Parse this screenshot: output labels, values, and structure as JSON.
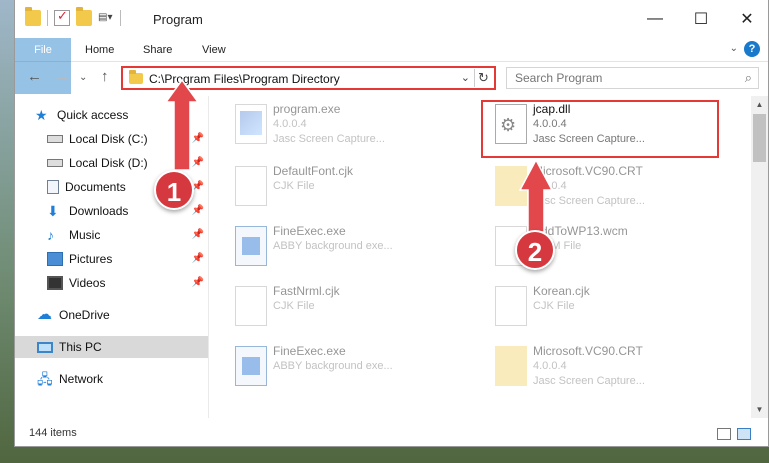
{
  "window": {
    "title": "Program"
  },
  "ribbon": {
    "tabs": [
      "File",
      "Home",
      "Share",
      "View"
    ],
    "help_icon": "?"
  },
  "address_bar": {
    "path": "C:\\Program Files\\Program Directory"
  },
  "search": {
    "placeholder": "Search Program"
  },
  "sidebar": {
    "items": [
      {
        "label": "Quick access",
        "icon": "star-icon",
        "pinned": false
      },
      {
        "label": "Local Disk (C:)",
        "icon": "disk-icon",
        "pinned": true
      },
      {
        "label": "Local Disk (D:)",
        "icon": "disk-icon",
        "pinned": true
      },
      {
        "label": "Documents",
        "icon": "documents-icon",
        "pinned": true
      },
      {
        "label": "Downloads",
        "icon": "downloads-icon",
        "pinned": true
      },
      {
        "label": "Music",
        "icon": "music-icon",
        "pinned": true
      },
      {
        "label": "Pictures",
        "icon": "pictures-icon",
        "pinned": true
      },
      {
        "label": "Videos",
        "icon": "videos-icon",
        "pinned": true
      },
      {
        "label": "OneDrive",
        "icon": "onedrive-icon",
        "pinned": false
      },
      {
        "label": "This PC",
        "icon": "this-pc-icon",
        "pinned": false,
        "selected": true
      },
      {
        "label": "Network",
        "icon": "network-icon",
        "pinned": false
      }
    ]
  },
  "files": [
    {
      "name": "program.exe",
      "line1": "4.0.0.4",
      "line2": "Jasc Screen Capture...",
      "icon": "exe-icon"
    },
    {
      "name": "jcap.dll",
      "line1": "4.0.0.4",
      "line2": "Jasc Screen Capture...",
      "icon": "dll-gear-icon",
      "highlighted": true
    },
    {
      "name": "DefaultFont.cjk",
      "line1": "CJK File",
      "line2": "",
      "icon": "blank-file-icon"
    },
    {
      "name": "Microsoft.VC90.CRT",
      "line1": "4.0.0.4",
      "line2": "Jasc Screen Capture...",
      "icon": "folder-icon"
    },
    {
      "name": "FineExec.exe",
      "line1": "ABBY background exe...",
      "line2": "",
      "icon": "window-app-icon"
    },
    {
      "name": "AddToWP13.wcm",
      "line1": "WCM File",
      "line2": "",
      "icon": "blank-file-icon"
    },
    {
      "name": "FastNrml.cjk",
      "line1": "CJK File",
      "line2": "",
      "icon": "blank-file-icon"
    },
    {
      "name": "Korean.cjk",
      "line1": "CJK File",
      "line2": "",
      "icon": "blank-file-icon"
    },
    {
      "name": "FineExec.exe",
      "line1": "ABBY background exe...",
      "line2": "",
      "icon": "window-app-icon"
    },
    {
      "name": "Microsoft.VC90.CRT",
      "line1": "4.0.0.4",
      "line2": "Jasc Screen Capture...",
      "icon": "folder-icon"
    }
  ],
  "status": {
    "item_count": "144 items"
  },
  "annotations": {
    "step1": "1",
    "step2": "2"
  },
  "colors": {
    "accent": "#1979ca",
    "annotation_red": "#e53935",
    "badge_red": "#d6383f"
  }
}
